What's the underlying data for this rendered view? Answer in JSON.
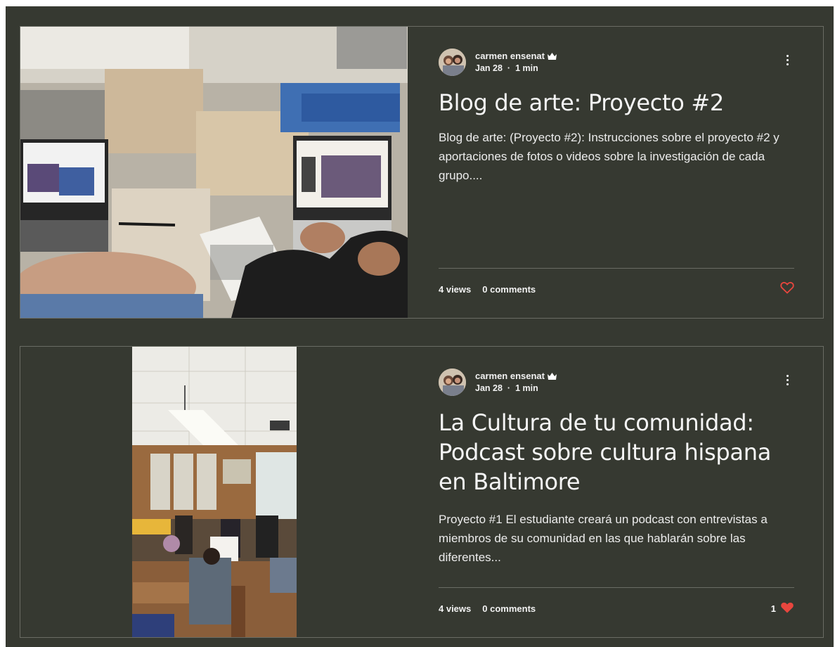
{
  "posts": [
    {
      "author": "carmen ensenat",
      "date": "Jan 28",
      "read_time": "1 min",
      "title": "Blog de arte: Proyecto #2",
      "excerpt": "Blog de arte: (Proyecto #2): Instrucciones sobre el proyecto #2 y aportaciones de fotos o videos sobre la investigación de cada grupo....",
      "views": "4 views",
      "comments": "0 comments",
      "likes": "",
      "liked": false
    },
    {
      "author": "carmen ensenat",
      "date": "Jan 28",
      "read_time": "1 min",
      "title": "La Cultura de tu comunidad: Podcast sobre cultura hispana en Baltimore",
      "excerpt": "Proyecto #1 El estudiante creará un podcast con entrevistas a miembros de su comunidad en las que hablarán sobre las diferentes...",
      "views": "4 views",
      "comments": "0 comments",
      "likes": "1",
      "liked": true
    }
  ],
  "icons": [
    "crown-icon",
    "more-options-icon",
    "heart-outline-icon",
    "heart-filled-icon"
  ],
  "colors": {
    "background": "#363931",
    "border": "#6a6c64",
    "heart": "#e8463e",
    "text": "#f2f2f2"
  }
}
